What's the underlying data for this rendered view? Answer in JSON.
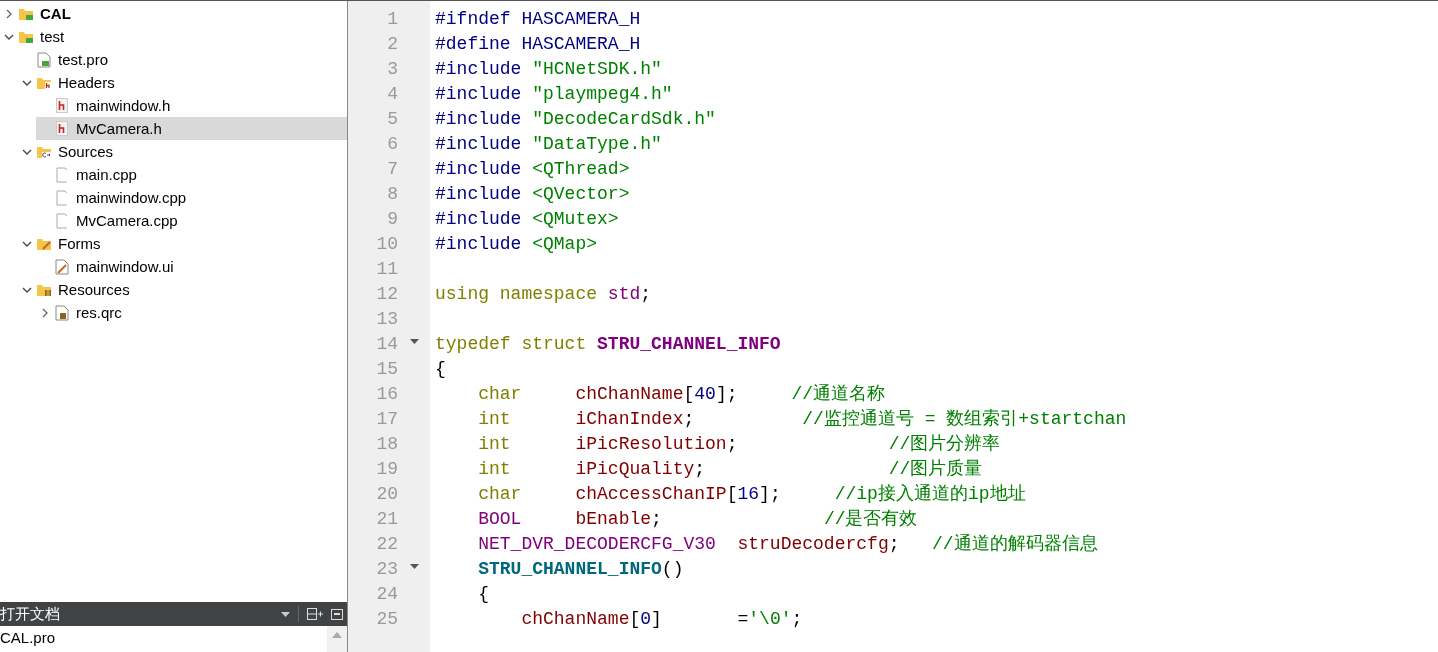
{
  "project_tree": {
    "items": [
      {
        "label": "CAL",
        "kind": "qt-folder",
        "active": true,
        "expanded": false,
        "selected": false
      },
      {
        "label": "test",
        "kind": "qt-folder",
        "active": false,
        "expanded": true,
        "selected": false,
        "children": [
          {
            "label": "test.pro",
            "kind": "qt-file",
            "selected": false
          },
          {
            "label": "Headers",
            "kind": "header-folder",
            "expanded": true,
            "selected": false,
            "children": [
              {
                "label": "mainwindow.h",
                "kind": "header-file",
                "selected": false
              },
              {
                "label": "MvCamera.h",
                "kind": "header-file",
                "selected": true
              }
            ]
          },
          {
            "label": "Sources",
            "kind": "source-folder",
            "expanded": true,
            "selected": false,
            "children": [
              {
                "label": "main.cpp",
                "kind": "source-file",
                "selected": false
              },
              {
                "label": "mainwindow.cpp",
                "kind": "source-file",
                "selected": false
              },
              {
                "label": "MvCamera.cpp",
                "kind": "source-file",
                "selected": false
              }
            ]
          },
          {
            "label": "Forms",
            "kind": "form-folder",
            "expanded": true,
            "selected": false,
            "children": [
              {
                "label": "mainwindow.ui",
                "kind": "form-file",
                "selected": false
              }
            ]
          },
          {
            "label": "Resources",
            "kind": "resource-folder",
            "expanded": true,
            "selected": false,
            "children": [
              {
                "label": "res.qrc",
                "kind": "resource-file",
                "expanded": false,
                "selected": false
              }
            ]
          }
        ]
      }
    ]
  },
  "open_documents": {
    "title": "打开文档",
    "items": [
      "CAL.pro"
    ]
  },
  "editor": {
    "lines": [
      {
        "number": "1",
        "foldable": false,
        "tokens": [
          {
            "t": "#ifndef HASCAMERA_H",
            "kind": "pre"
          }
        ]
      },
      {
        "number": "2",
        "foldable": false,
        "tokens": [
          {
            "t": "#define HASCAMERA_H",
            "kind": "pre"
          }
        ]
      },
      {
        "number": "3",
        "foldable": false,
        "tokens": [
          {
            "t": "#include ",
            "kind": "pre"
          },
          {
            "t": "\"HCNetSDK.h\"",
            "kind": "str"
          }
        ]
      },
      {
        "number": "4",
        "foldable": false,
        "tokens": [
          {
            "t": "#include ",
            "kind": "pre"
          },
          {
            "t": "\"plaympeg4.h\"",
            "kind": "str"
          }
        ]
      },
      {
        "number": "5",
        "foldable": false,
        "tokens": [
          {
            "t": "#include ",
            "kind": "pre"
          },
          {
            "t": "\"DecodeCardSdk.h\"",
            "kind": "str"
          }
        ]
      },
      {
        "number": "6",
        "foldable": false,
        "tokens": [
          {
            "t": "#include ",
            "kind": "pre"
          },
          {
            "t": "\"DataType.h\"",
            "kind": "str"
          }
        ]
      },
      {
        "number": "7",
        "foldable": false,
        "tokens": [
          {
            "t": "#include ",
            "kind": "pre"
          },
          {
            "t": "<QThread>",
            "kind": "str"
          }
        ]
      },
      {
        "number": "8",
        "foldable": false,
        "tokens": [
          {
            "t": "#include ",
            "kind": "pre"
          },
          {
            "t": "<QVector>",
            "kind": "str"
          }
        ]
      },
      {
        "number": "9",
        "foldable": false,
        "tokens": [
          {
            "t": "#include ",
            "kind": "pre"
          },
          {
            "t": "<QMutex>",
            "kind": "str"
          }
        ]
      },
      {
        "number": "10",
        "foldable": false,
        "tokens": [
          {
            "t": "#include ",
            "kind": "pre"
          },
          {
            "t": "<QMap>",
            "kind": "str"
          }
        ]
      },
      {
        "number": "11",
        "foldable": false
      },
      {
        "number": "12",
        "foldable": false,
        "tokens": [
          {
            "t": "using namespace ",
            "kind": "kw"
          },
          {
            "t": "std",
            "kind": "type"
          },
          {
            "t": ";",
            "kind": "plain"
          }
        ]
      },
      {
        "number": "13",
        "foldable": false
      },
      {
        "number": "14",
        "foldable": true,
        "tokens": [
          {
            "t": "typedef struct ",
            "kind": "kw"
          },
          {
            "t": "STRU_CHANNEL_INFO",
            "kind": "type-bold"
          }
        ]
      },
      {
        "number": "15",
        "foldable": false,
        "tokens": [
          {
            "t": "{",
            "kind": "plain"
          }
        ]
      },
      {
        "number": "16",
        "foldable": false,
        "tokens": [
          {
            "t": "    char     ",
            "kind": "kw"
          },
          {
            "t": "chChanName",
            "kind": "field"
          },
          {
            "t": "[",
            "kind": "plain"
          },
          {
            "t": "40",
            "kind": "num"
          },
          {
            "t": "];     ",
            "kind": "plain"
          },
          {
            "t": "//通道名称",
            "kind": "com"
          }
        ]
      },
      {
        "number": "17",
        "foldable": false,
        "tokens": [
          {
            "t": "    int      ",
            "kind": "kw"
          },
          {
            "t": "iChanIndex",
            "kind": "field"
          },
          {
            "t": ";          ",
            "kind": "plain"
          },
          {
            "t": "//监控通道号 = 数组索引+startchan",
            "kind": "com"
          }
        ]
      },
      {
        "number": "18",
        "foldable": false,
        "tokens": [
          {
            "t": "    int      ",
            "kind": "kw"
          },
          {
            "t": "iPicResolution",
            "kind": "field"
          },
          {
            "t": ";              ",
            "kind": "plain"
          },
          {
            "t": "//图片分辨率",
            "kind": "com"
          }
        ]
      },
      {
        "number": "19",
        "foldable": false,
        "tokens": [
          {
            "t": "    int      ",
            "kind": "kw"
          },
          {
            "t": "iPicQuality",
            "kind": "field"
          },
          {
            "t": ";                 ",
            "kind": "plain"
          },
          {
            "t": "//图片质量",
            "kind": "com"
          }
        ]
      },
      {
        "number": "20",
        "foldable": false,
        "tokens": [
          {
            "t": "    char     ",
            "kind": "kw"
          },
          {
            "t": "chAccessChanIP",
            "kind": "field"
          },
          {
            "t": "[",
            "kind": "plain"
          },
          {
            "t": "16",
            "kind": "num"
          },
          {
            "t": "];     ",
            "kind": "plain"
          },
          {
            "t": "//ip接入通道的ip地址",
            "kind": "com"
          }
        ]
      },
      {
        "number": "21",
        "foldable": false,
        "tokens": [
          {
            "t": "    BOOL     ",
            "kind": "type"
          },
          {
            "t": "bEnable",
            "kind": "field"
          },
          {
            "t": ";               ",
            "kind": "plain"
          },
          {
            "t": "//是否有效",
            "kind": "com"
          }
        ]
      },
      {
        "number": "22",
        "foldable": false,
        "tokens": [
          {
            "t": "    NET_DVR_DECODERCFG_V30  ",
            "kind": "type"
          },
          {
            "t": "struDecodercfg",
            "kind": "field"
          },
          {
            "t": ";   ",
            "kind": "plain"
          },
          {
            "t": "//通道的解码器信息",
            "kind": "com"
          }
        ]
      },
      {
        "number": "23",
        "foldable": true,
        "tokens": [
          {
            "t": "    STRU_CHANNEL_INFO",
            "kind": "ctor"
          },
          {
            "t": "()",
            "kind": "plain"
          }
        ]
      },
      {
        "number": "24",
        "foldable": false,
        "tokens": [
          {
            "t": "    {",
            "kind": "plain"
          }
        ]
      },
      {
        "number": "25",
        "foldable": false,
        "tokens": [
          {
            "t": "        chChanName",
            "kind": "field"
          },
          {
            "t": "[",
            "kind": "plain"
          },
          {
            "t": "0",
            "kind": "num"
          },
          {
            "t": "]       =",
            "kind": "plain"
          },
          {
            "t": "'\\0'",
            "kind": "str"
          },
          {
            "t": ";",
            "kind": "plain"
          }
        ]
      }
    ]
  }
}
